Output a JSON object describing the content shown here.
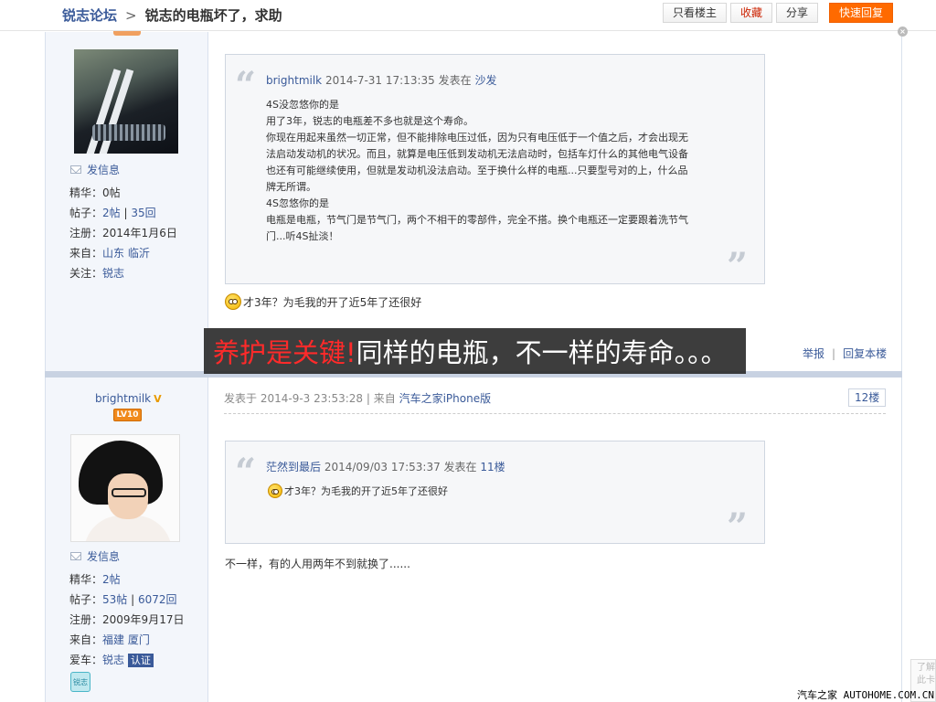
{
  "header": {
    "forum_name": "锐志论坛",
    "separator": ">",
    "thread_title": "锐志的电瓶坏了，求助",
    "btn_only_op": "只看楼主",
    "btn_fav": "收藏",
    "btn_share": "分享",
    "btn_quick_reply": "快速回复"
  },
  "post1": {
    "author": {
      "send_message": "发信息",
      "essence_label": "精华：",
      "essence_value": "0帖",
      "posts_label": "帖子：",
      "posts_count": "2帖",
      "posts_sep": " | ",
      "replies_count": "35回",
      "reg_label": "注册：",
      "reg_date": "2014年1月6日",
      "from_label": "来自：",
      "from_province": "山东",
      "from_city": "临沂",
      "follow_label": "关注：",
      "follow_value": "锐志"
    },
    "quote": {
      "user": "brightmilk",
      "time": "2014-7-31 17:13:35",
      "posted_in": "发表在",
      "floor": "沙发",
      "lines": [
        "4S没忽悠你的是",
        "用了3年，锐志的电瓶差不多也就是这个寿命。",
        "你现在用起来虽然一切正常，但不能排除电压过低，因为只有电压低于一个值之后，才会出现无",
        "法启动发动机的状况。而且，就算是电压低到发动机无法启动时，包括车灯什么的其他电气设备",
        "也还有可能继续使用，但就是发动机没法启动。至于换什么样的电瓶...只要型号对的上，什么品",
        "牌无所谓。",
        "4S忽悠你的是",
        "电瓶是电瓶，节气门是节气门，两个不相干的零部件，完全不搭。换个电瓶还一定要跟着洗节气",
        "门...听4S扯淡！"
      ]
    },
    "reply": "才3年？为毛我的开了近5年了还很好",
    "action_report": "举报",
    "action_sep": "|",
    "action_reply": "回复本楼"
  },
  "overlay": {
    "red_text": "养护是关键!",
    "white_text": "同样的电瓶，不一样的寿命。。。"
  },
  "post2": {
    "author": {
      "username": "brightmilk",
      "verified_mark": "V",
      "level": "LV10",
      "send_message": "发信息",
      "essence_label": "精华：",
      "essence_value": "2帖",
      "posts_label": "帖子：",
      "posts_count": "53帖",
      "posts_sep": " | ",
      "replies_count": "6072回",
      "reg_label": "注册：",
      "reg_date": "2009年9月17日",
      "from_label": "来自：",
      "from_province": "福建",
      "from_city": "厦门",
      "car_label": "爱车：",
      "car_value": "锐志",
      "auth_badge": "认证",
      "car_icon_text": "锐志"
    },
    "meta_prefix": "发表于",
    "time": "2014-9-3 23:53:28",
    "meta_sep": "|",
    "from_prefix": "来自",
    "source": "汽车之家iPhone版",
    "floor": "12楼",
    "quote": {
      "user": "茫然到最后",
      "time": "2014/09/03 17:53:37",
      "posted_in": "发表在",
      "floor": "11楼",
      "text": "才3年？为毛我的开了近5年了还很好"
    },
    "reply": "不一样，有的人用两年不到就换了......"
  },
  "watermark": "汽车之家 AUTOHOME.COM.CN",
  "corner_text": "了解 此卡"
}
